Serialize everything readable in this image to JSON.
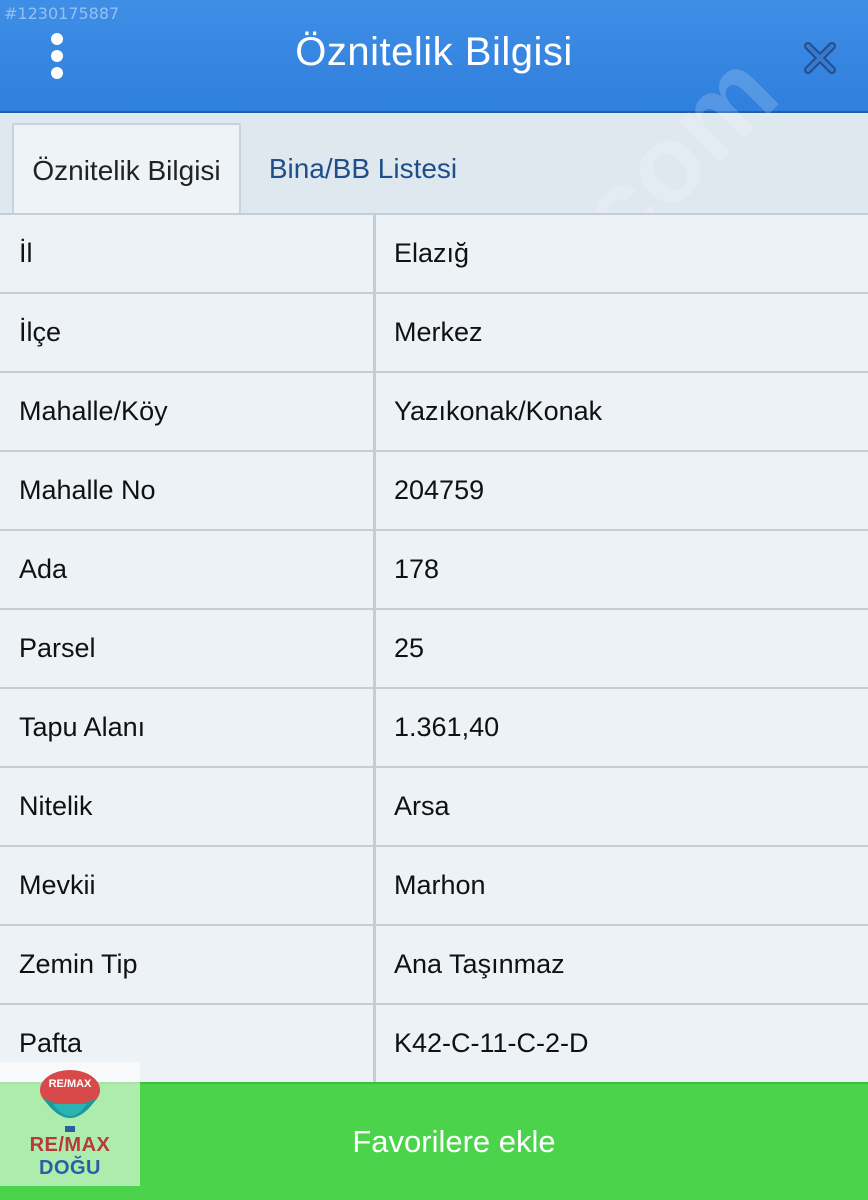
{
  "header": {
    "listing_id": "#1230175887",
    "title": "Öznitelik Bilgisi",
    "menu_icon": "kebab-menu-icon",
    "close_icon": "close-icon"
  },
  "tabs": [
    {
      "label": "Öznitelik Bilgisi",
      "active": true
    },
    {
      "label": "Bina/BB Listesi",
      "active": false
    }
  ],
  "attributes": [
    {
      "label": "İl",
      "value": "Elazığ"
    },
    {
      "label": "İlçe",
      "value": "Merkez"
    },
    {
      "label": "Mahalle/Köy",
      "value": "Yazıkonak/Konak"
    },
    {
      "label": "Mahalle No",
      "value": "204759"
    },
    {
      "label": "Ada",
      "value": "178"
    },
    {
      "label": "Parsel",
      "value": "25"
    },
    {
      "label": "Tapu Alanı",
      "value": "1.361,40"
    },
    {
      "label": "Nitelik",
      "value": "Arsa"
    },
    {
      "label": "Mevkii",
      "value": "Marhon"
    },
    {
      "label": "Zemin Tip",
      "value": "Ana Taşınmaz"
    },
    {
      "label": "Pafta",
      "value": "K42-C-11-C-2-D"
    }
  ],
  "footer": {
    "button_label": "Favorilere ekle"
  },
  "logo": {
    "top_text": "RE/MAX",
    "brand": "RE/MAX",
    "sub": "DOĞU"
  },
  "colors": {
    "header": "#3a8ae4",
    "footer": "#4bd44b",
    "tab_text": "#1e4f8a"
  }
}
